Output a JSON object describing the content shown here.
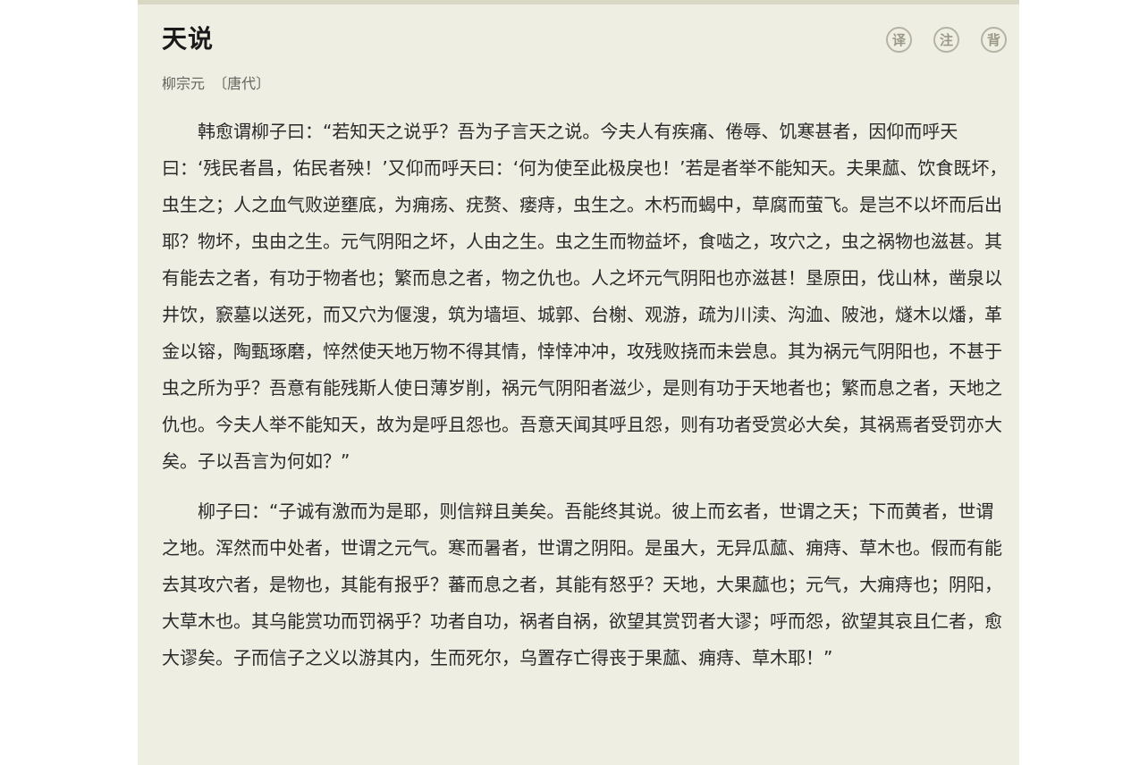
{
  "poem": {
    "title": "天说",
    "author": "柳宗元",
    "dynasty": "〔唐代〕",
    "paragraphs": [
      "韩愈谓柳子曰：“若知天之说乎？吾为子言天之说。今夫人有疾痛、倦辱、饥寒甚者，因仰而呼天曰：‘残民者昌，佑民者殃！’又仰而呼天曰：‘何为使至此极戾也！’若是者举不能知天。夫果蓏、饮食既坏，虫生之；人之血气败逆壅底，为痈疡、疣赘、瘘痔，虫生之。木朽而蝎中，草腐而萤飞。是岂不以坏而后出耶？物坏，虫由之生。元气阴阳之坏，人由之生。虫之生而物益坏，食啮之，攻穴之，虫之祸物也滋甚。其有能去之者，有功于物者也；繁而息之者，物之仇也。人之坏元气阴阳也亦滋甚！垦原田，伐山林，凿泉以井饮，窾墓以送死，而又穴为偃溲，筑为墙垣、城郭、台榭、观游，疏为川渎、沟洫、陂池，燧木以燔，革金以镕，陶甄琢磨，悴然使天地万物不得其情，悻悻冲冲，攻残败挠而未尝息。其为祸元气阴阳也，不甚于虫之所为乎？吾意有能残斯人使日薄岁削，祸元气阴阳者滋少，是则有功于天地者也；繁而息之者，天地之仇也。今夫人举不能知天，故为是呼且怨也。吾意天闻其呼且怨，则有功者受赏必大矣，其祸焉者受罚亦大矣。子以吾言为何如？”",
      "柳子曰：“子诚有激而为是耶，则信辩且美矣。吾能终其说。彼上而玄者，世谓之天；下而黄者，世谓之地。浑然而中处者，世谓之元气。寒而暑者，世谓之阴阳。是虽大，无异瓜蓏、痈痔、草木也。假而有能去其攻穴者，是物也，其能有报乎？蕃而息之者，其能有怒乎？天地，大果蓏也；元气，大痈痔也；阴阳，大草木也。其乌能赏功而罚祸乎？功者自功，祸者自祸，欲望其赏罚者大谬；呼而怨，欲望其哀且仁者，愈大谬矣。子而信子之义以游其内，生而死尔，乌置存亡得丧于果蓏、痈痔、草木耶！”"
    ]
  },
  "toolbar": {
    "translate_label": "译",
    "annotate_label": "注",
    "recite_label": "背"
  },
  "colors": {
    "page_background": "#efeee2",
    "text": "#2a2a2a",
    "muted_text": "#65645f",
    "button_border": "#b5b4a4"
  }
}
